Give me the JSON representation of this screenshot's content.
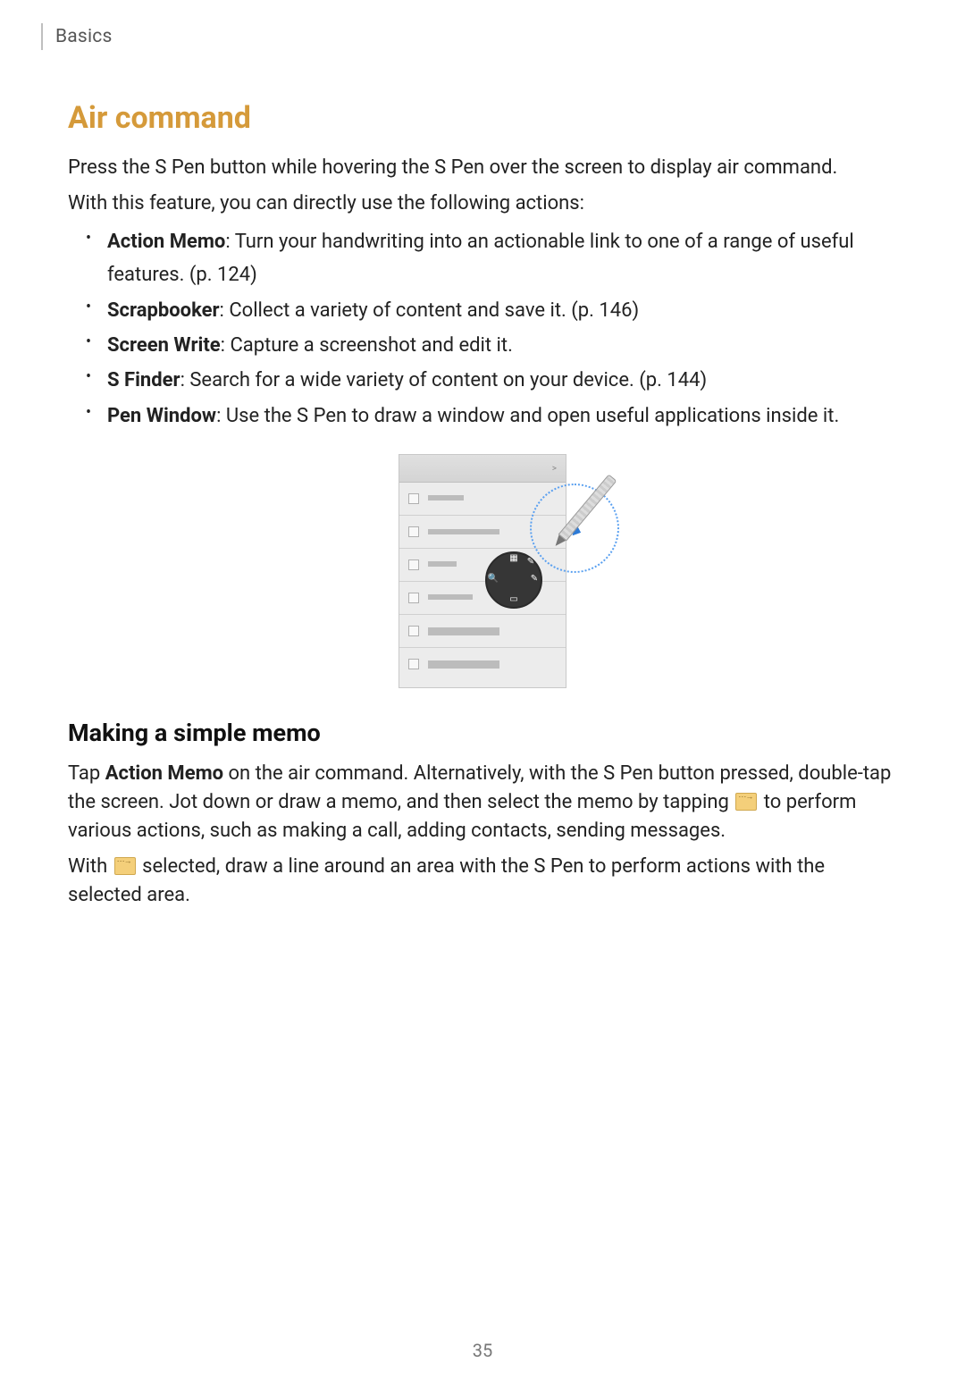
{
  "header": {
    "section": "Basics"
  },
  "main": {
    "title": "Air command",
    "intro1": "Press the S Pen button while hovering the S Pen over the screen to display air command.",
    "intro2": "With this feature, you can directly use the following actions:",
    "features": [
      {
        "name": "Action Memo",
        "desc": ": Turn your handwriting into an actionable link to one of a range of useful features. (p. 124)"
      },
      {
        "name": "Scrapbooker",
        "desc": ": Collect a variety of content and save it. (p. 146)"
      },
      {
        "name": "Screen Write",
        "desc": ": Capture a screenshot and edit it."
      },
      {
        "name": "S Finder",
        "desc": ": Search for a wide variety of content on your device. (p. 144)"
      },
      {
        "name": "Pen Window",
        "desc": ": Use the S Pen to draw a window and open useful applications inside it."
      }
    ]
  },
  "illustration_header_glyph": ">",
  "subsection": {
    "heading": "Making a simple memo",
    "p1a": "Tap ",
    "p1b": "Action Memo",
    "p1c": " on the air command. Alternatively, with the S Pen button pressed, double-tap the screen. Jot down or draw a memo, and then select the memo by tapping ",
    "p1d": " to perform various actions, such as making a call, adding contacts, sending messages.",
    "p2a": "With ",
    "p2b": " selected, draw a line around an area with the S Pen to perform actions with the selected area."
  },
  "page_number": "35"
}
